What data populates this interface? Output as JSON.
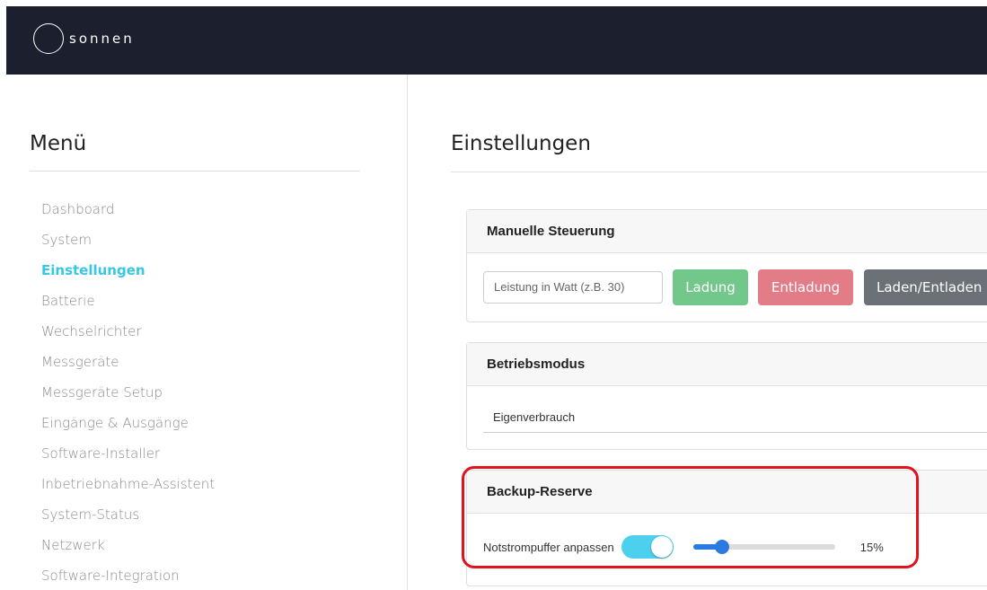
{
  "header": {
    "logo_text": "sonnen"
  },
  "sidebar": {
    "title": "Menü",
    "items": [
      {
        "label": "Dashboard"
      },
      {
        "label": "System"
      },
      {
        "label": "Einstellungen",
        "active": true
      },
      {
        "label": "Batterie"
      },
      {
        "label": "Wechselrichter"
      },
      {
        "label": "Messgeräte"
      },
      {
        "label": "Messgeräte Setup"
      },
      {
        "label": "Eingänge & Ausgänge"
      },
      {
        "label": "Software-Installer"
      },
      {
        "label": "Inbetriebnahme-Assistent"
      },
      {
        "label": "System-Status"
      },
      {
        "label": "Netzwerk"
      },
      {
        "label": "Software-Integration"
      }
    ]
  },
  "main": {
    "title": "Einstellungen",
    "manual": {
      "title": "Manuelle Steuerung",
      "watt_placeholder": "Leistung in Watt (z.B. 30)",
      "btn_charge": "Ladung",
      "btn_discharge": "Entladung",
      "btn_both": "Laden/Entladen"
    },
    "mode": {
      "title": "Betriebsmodus",
      "value": "Eigenverbrauch"
    },
    "backup": {
      "title": "Backup-Reserve",
      "toggle_label": "Notstrompuffer anpassen",
      "toggle_on": true,
      "slider_value": 15,
      "slider_text": "15%"
    }
  },
  "colors": {
    "header_bg": "#1c1f2e",
    "accent": "#38c6e5",
    "charge": "#72c78b",
    "discharge": "#e27c86",
    "neutral": "#6b7177",
    "slider": "#2a7ae2",
    "highlight": "#e3111b"
  }
}
